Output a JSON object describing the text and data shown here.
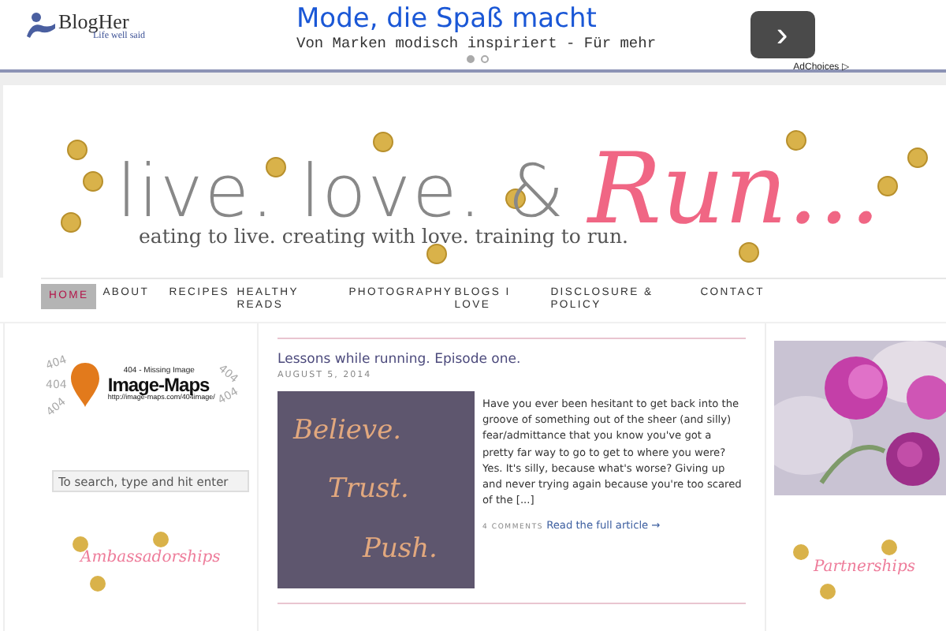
{
  "ad": {
    "brand": "BlogHer",
    "brand_tagline": "Life well said",
    "headline": "Mode, die Spaß macht",
    "body": "Von Marken modisch inspiriert - Für mehr",
    "next_icon": "›",
    "slides": [
      {
        "selected": true
      },
      {
        "selected": false
      }
    ],
    "adchoices": "AdChoices ▷"
  },
  "header": {
    "title": "live. love. &",
    "title_accent": "Run...",
    "tagline": "eating to live. creating with love. training to run."
  },
  "nav": [
    {
      "label": "HOME",
      "selected": true
    },
    {
      "label": "ABOUT",
      "selected": false
    },
    {
      "label": "RECIPES",
      "selected": false
    },
    {
      "label": "HEALTHY READS",
      "selected": false
    },
    {
      "label": "PHOTOGRAPHY",
      "selected": false
    },
    {
      "label": "BLOGS I LOVE",
      "selected": false
    },
    {
      "label": "DISCLOSURE & POLICY",
      "selected": false
    },
    {
      "label": "CONTACT",
      "selected": false
    }
  ],
  "left_sidebar": {
    "missing_image": {
      "caption": "404 - Missing Image",
      "brand": "Image-Maps",
      "url": "http://image-maps.com/404image/",
      "marks": [
        "404",
        "404",
        "404",
        "404",
        "404"
      ]
    },
    "search": {
      "placeholder": "To search, type and hit enter"
    },
    "widget_title": "Ambassadorships"
  },
  "post": {
    "title": "Lessons while running. Episode one.",
    "date": "AUGUST 5, 2014",
    "image_words": [
      "Believe.",
      "Trust.",
      "Push."
    ],
    "excerpt": "Have you ever been hesitant to get back into the groove of something out of the sheer (and silly) fear/admittance that you know you've got a pretty far way to go to get to where you were? Yes. It's silly, because what's worse? Giving up and never trying again because you're too scared of the [...]",
    "comments": "4 COMMENTS",
    "read_more": "Read the full article →"
  },
  "right_sidebar": {
    "widget_title": "Partnerships"
  }
}
